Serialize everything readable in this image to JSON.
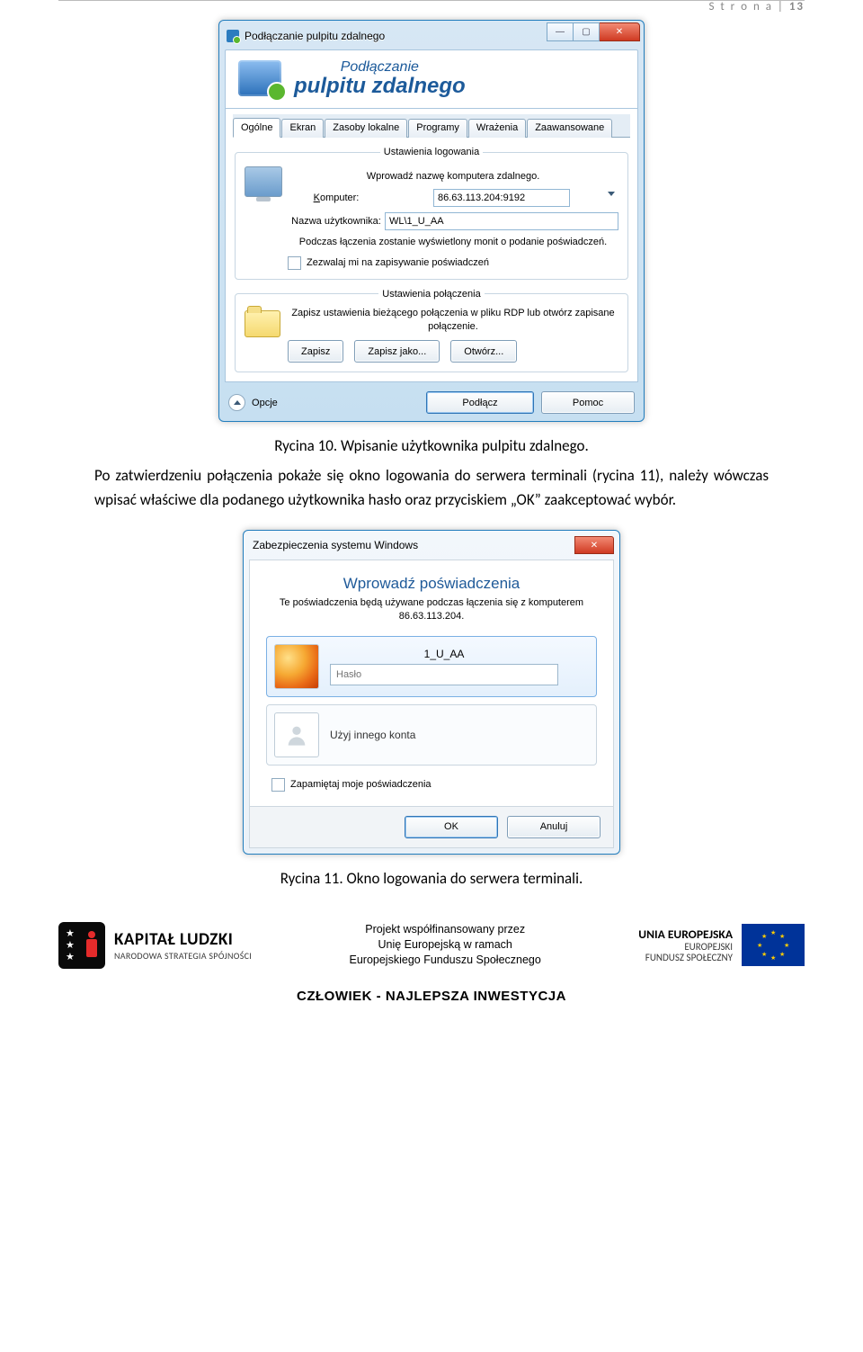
{
  "page": {
    "header_label": "S t r o n a",
    "page_number": "13"
  },
  "figure1": {
    "window_title": "Podłączanie pulpitu zdalnego",
    "banner_line1": "Podłączanie",
    "banner_line2": "pulpitu zdalnego",
    "tabs": [
      "Ogólne",
      "Ekran",
      "Zasoby lokalne",
      "Programy",
      "Wrażenia",
      "Zaawansowane"
    ],
    "login_group": {
      "legend": "Ustawienia logowania",
      "intro": "Wprowadź nazwę komputera zdalnego.",
      "computer_label": "Komputer:",
      "computer_value": "86.63.113.204:9192",
      "user_label": "Nazwa użytkownika:",
      "user_value": "WL\\1_U_AA",
      "note": "Podczas łączenia zostanie wyświetlony monit o podanie poświadczeń.",
      "checkbox": "Zezwalaj mi na zapisywanie poświadczeń"
    },
    "conn_group": {
      "legend": "Ustawienia połączenia",
      "text": "Zapisz ustawienia bieżącego połączenia w pliku RDP lub otwórz zapisane połączenie.",
      "save": "Zapisz",
      "save_as": "Zapisz jako...",
      "open": "Otwórz..."
    },
    "footer": {
      "options": "Opcje",
      "connect": "Podłącz",
      "help": "Pomoc"
    },
    "caption": "Rycina 10. Wpisanie użytkownika pulpitu zdalnego."
  },
  "body_paragraph": "Po zatwierdzeniu połączenia pokaże się okno logowania do serwera terminali (rycina 11), należy wówczas wpisać właściwe dla podanego użytkownika hasło oraz przyciskiem „OK” zaakceptować wybór.",
  "figure2": {
    "window_title": "Zabezpieczenia systemu Windows",
    "heading": "Wprowadź poświadczenia",
    "subtext": "Te poświadczenia będą używane podczas łączenia się z komputerem 86.63.113.204.",
    "username": "1_U_AA",
    "password_placeholder": "Hasło",
    "other_account": "Użyj innego konta",
    "remember": "Zapamiętaj moje poświadczenia",
    "ok": "OK",
    "cancel": "Anuluj",
    "caption": "Rycina 11. Okno logowania do serwera terminali."
  },
  "footer": {
    "kl_line1": "KAPITAŁ LUDZKI",
    "kl_line2": "NARODOWA STRATEGIA SPÓJNOŚCI",
    "mid_line1": "Projekt współfinansowany przez",
    "mid_line2": "Unię Europejską w ramach",
    "mid_line3": "Europejskiego Funduszu Społecznego",
    "ue_line1": "UNIA EUROPEJSKA",
    "ue_line2": "EUROPEJSKI",
    "ue_line3": "FUNDUSZ SPOŁECZNY",
    "slogan": "CZŁOWIEK - NAJLEPSZA INWESTYCJA"
  }
}
